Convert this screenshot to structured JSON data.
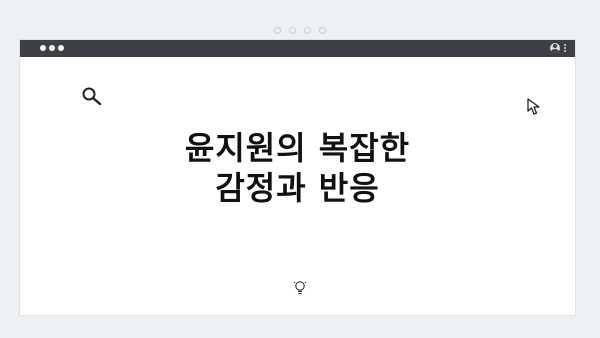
{
  "headline": {
    "line1": "윤지원의 복잡한",
    "line2": "감정과 반응"
  },
  "icons": {
    "top_dots": "pagination-dots-icon",
    "traffic_lights": "window-controls-icon",
    "user": "user-icon",
    "menu": "kebab-menu-icon",
    "search": "search-icon",
    "cursor": "cursor-icon",
    "bulb": "lightbulb-icon"
  },
  "colors": {
    "background": "#eef1f4",
    "titlebar": "#3e4045",
    "card": "#ffffff",
    "text": "#111111"
  }
}
